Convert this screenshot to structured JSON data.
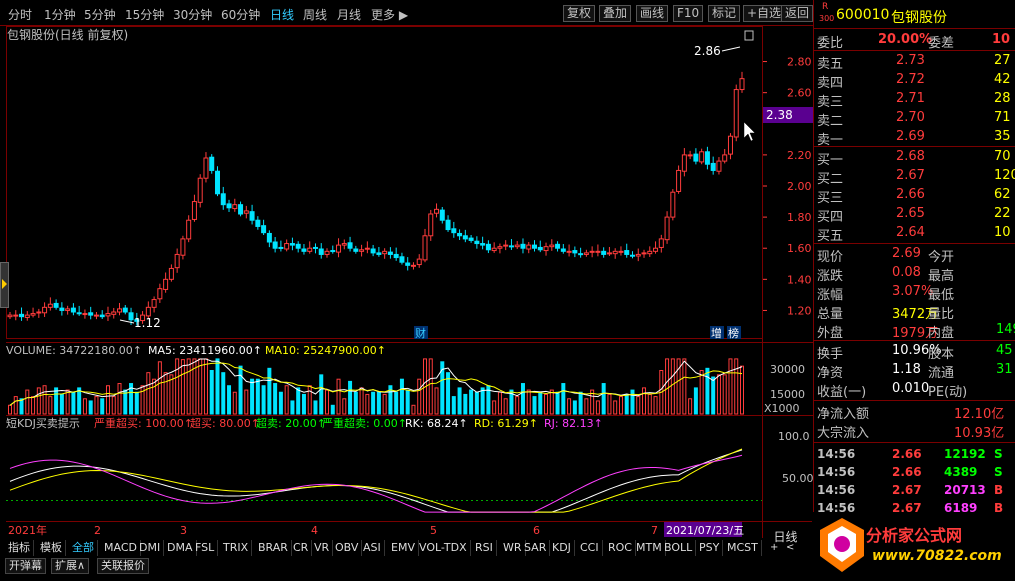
{
  "toolbar": {
    "periods": [
      "分时",
      "1分钟",
      "5分钟",
      "15分钟",
      "30分钟",
      "60分钟",
      "日线",
      "周线",
      "月线",
      "更多 ▶"
    ],
    "active_period": "日线",
    "buttons": [
      "复权",
      "叠加",
      "画线",
      "F10",
      "标记",
      "+自选",
      "返回"
    ]
  },
  "chart": {
    "title": "包钢股份(日线 前复权)",
    "price_ticks": [
      "2.80",
      "2.60",
      "2.20",
      "2.00",
      "1.80",
      "1.60",
      "1.40",
      "1.20"
    ],
    "current_price_tag": "2.38",
    "high_label": "2.86",
    "low_label": "1.12",
    "markers": {
      "cai": "财",
      "zeng": "增",
      "bang": "榜"
    },
    "volume_header": {
      "label": "VOLUME: 34722180.00↑",
      "ma5": "MA5: 23411960.00↑",
      "ma10": "MA10: 25247900.00↑"
    },
    "volume_ticks": [
      "30000",
      "15000",
      "X1000"
    ],
    "kdj_header": {
      "label": "短KDJ买卖提示",
      "s1": "严重超买: 100.00↑",
      "s2": "超买: 80.00↑",
      "s3": "超卖: 20.00↑",
      "s4": "严重超卖: 0.00↑",
      "rk": "RK: 68.24↑",
      "rd": "RD: 61.29↑",
      "rj": "RJ: 82.13↑"
    },
    "kdj_ticks": [
      "100.0",
      "50.00"
    ],
    "date_axis": [
      "2021年",
      "2",
      "3",
      "4",
      "5",
      "6",
      "7"
    ],
    "date_tag": "2021/07/23/五",
    "colors": {
      "up": "#ff3c3c",
      "down": "#00e4ff",
      "ma5": "#ffffff",
      "ma10": "#ffff00",
      "rk": "#ffffff",
      "rd": "#ffff00",
      "rj": "#ff40ff",
      "grid": "#7a0000"
    }
  },
  "chart_data": {
    "type": "candlestick",
    "title": "包钢股份(日线 前复权)",
    "ylim": [
      1.1,
      2.9
    ],
    "close": [
      1.17,
      1.17,
      1.16,
      1.17,
      1.18,
      1.19,
      1.22,
      1.24,
      1.22,
      1.2,
      1.21,
      1.19,
      1.18,
      1.18,
      1.17,
      1.17,
      1.16,
      1.18,
      1.19,
      1.21,
      1.19,
      1.14,
      1.13,
      1.17,
      1.22,
      1.27,
      1.34,
      1.4,
      1.47,
      1.56,
      1.66,
      1.78,
      1.9,
      2.05,
      2.18,
      2.1,
      1.95,
      1.88,
      1.86,
      1.88,
      1.82,
      1.84,
      1.78,
      1.74,
      1.7,
      1.64,
      1.6,
      1.6,
      1.63,
      1.62,
      1.6,
      1.58,
      1.6,
      1.6,
      1.56,
      1.58,
      1.58,
      1.62,
      1.63,
      1.6,
      1.58,
      1.59,
      1.6,
      1.57,
      1.56,
      1.58,
      1.56,
      1.54,
      1.51,
      1.49,
      1.49,
      1.53,
      1.68,
      1.82,
      1.85,
      1.78,
      1.72,
      1.7,
      1.68,
      1.66,
      1.65,
      1.63,
      1.62,
      1.59,
      1.6,
      1.61,
      1.62,
      1.61,
      1.62,
      1.6,
      1.62,
      1.6,
      1.59,
      1.61,
      1.62,
      1.6,
      1.58,
      1.58,
      1.57,
      1.56,
      1.57,
      1.58,
      1.58,
      1.56,
      1.57,
      1.58,
      1.58,
      1.56,
      1.55,
      1.56,
      1.57,
      1.58,
      1.6,
      1.66,
      1.8,
      1.96,
      2.1,
      2.2,
      2.2,
      2.16,
      2.22,
      2.14,
      2.1,
      2.16,
      2.2,
      2.32,
      2.62,
      2.69
    ],
    "volume_scale": "X1000",
    "volume_ylim": [
      0,
      40000
    ],
    "kdj": {
      "RK": 68.24,
      "RD": 61.29,
      "RJ": 82.13,
      "ylim": [
        0,
        110
      ]
    }
  },
  "quote": {
    "r": "R",
    "r2": "300",
    "code": "600010",
    "name": "包钢股份",
    "weibi_label": "委比",
    "weibi": "20.00%",
    "weicha_label": "委差",
    "weicha": "10",
    "asks": [
      {
        "label": "卖五",
        "price": "2.73",
        "vol": "27"
      },
      {
        "label": "卖四",
        "price": "2.72",
        "vol": "42"
      },
      {
        "label": "卖三",
        "price": "2.71",
        "vol": "28"
      },
      {
        "label": "卖二",
        "price": "2.70",
        "vol": "71"
      },
      {
        "label": "卖一",
        "price": "2.69",
        "vol": "35"
      }
    ],
    "bids": [
      {
        "label": "买一",
        "price": "2.68",
        "vol": "70"
      },
      {
        "label": "买二",
        "price": "2.67",
        "vol": "120"
      },
      {
        "label": "买三",
        "price": "2.66",
        "vol": "62"
      },
      {
        "label": "买四",
        "price": "2.65",
        "vol": "22"
      },
      {
        "label": "买五",
        "price": "2.64",
        "vol": "10"
      }
    ],
    "stats": [
      {
        "k": "现价",
        "v": "2.69",
        "k2": "今开",
        "v2": ""
      },
      {
        "k": "涨跌",
        "v": "0.08",
        "k2": "最高",
        "v2": ""
      },
      {
        "k": "涨幅",
        "v": "3.07%",
        "k2": "最低",
        "v2": ""
      },
      {
        "k": "总量",
        "v": "3472万",
        "k2": "量比",
        "v2": ""
      },
      {
        "k": "外盘",
        "v": "1979万",
        "k2": "内盘",
        "v2": "149"
      }
    ],
    "stats2": [
      {
        "k": "换手",
        "v": "10.96%",
        "k2": "股本",
        "v2": "45"
      },
      {
        "k": "净资",
        "v": "1.18",
        "k2": "流通",
        "v2": "31"
      },
      {
        "k": "收益(一)",
        "v": "0.010",
        "k2": "PE(动)",
        "v2": ""
      }
    ],
    "flow": [
      {
        "k": "净流入额",
        "v": "12.10亿"
      },
      {
        "k": "大宗流入",
        "v": "10.93亿"
      }
    ],
    "ticks": [
      {
        "t": "14:56",
        "p": "2.66",
        "v": "12192",
        "s": "S"
      },
      {
        "t": "14:56",
        "p": "2.66",
        "v": "4389",
        "s": "S"
      },
      {
        "t": "14:56",
        "p": "2.67",
        "v": "20713",
        "s": "B"
      },
      {
        "t": "14:56",
        "p": "2.67",
        "v": "6189",
        "s": "B"
      }
    ]
  },
  "bottom": {
    "row1": [
      "指标",
      "模板",
      "全部",
      "MACD",
      "DMI",
      "DMA",
      "FSL",
      "TRIX",
      "BRAR",
      "CR",
      "VR",
      "OBV",
      "ASI",
      "EMV",
      "VOL-TDX",
      "RSI",
      "WR",
      "SAR",
      "KDJ",
      "CCI",
      "ROC",
      "MTM",
      "BOLL",
      "PSY",
      "MCST"
    ],
    "row2": [
      "开弹幕",
      "扩展∧",
      "关联报价"
    ],
    "period_label": "日线",
    "watermark_title": "分析家公式网",
    "watermark_url": "www.70822.com"
  }
}
